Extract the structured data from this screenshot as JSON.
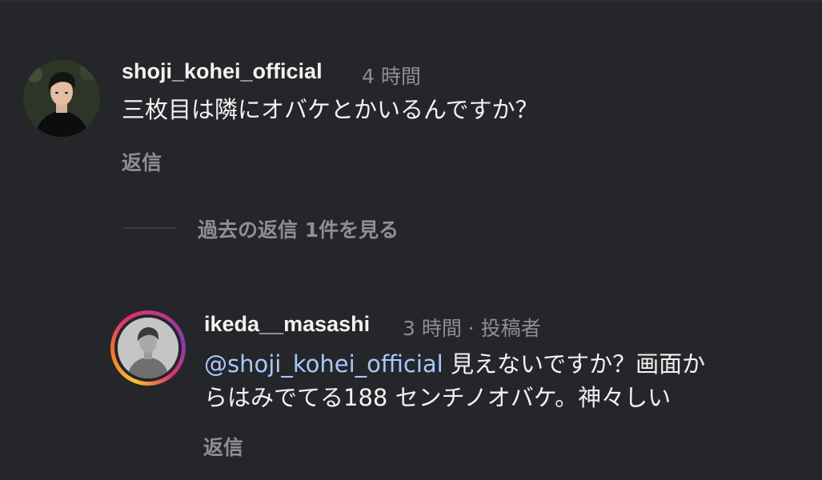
{
  "comments": [
    {
      "username": "shoji_kohei_official",
      "time": "4 時間",
      "text": "三枚目は隣にオバケとかいるんですか？",
      "reply_label": "返信"
    }
  ],
  "view_replies_label": "過去の返信 1件を見る",
  "reply": {
    "username": "ikeda__masashi",
    "time_meta": "3 時間 · 投稿者",
    "mention": "@shoji_kohei_official",
    "text_line1_rest": " 見えないですか？画面か",
    "text_line2": "らはみでてる188 センチノオバケ。神々しい",
    "reply_label": "返信"
  },
  "colors": {
    "background": "#252629",
    "text_primary": "#f2f2f2",
    "text_secondary": "#8e8f94",
    "mention": "#a8c8ff",
    "story_ring": [
      "#f6c236",
      "#ef7a2c",
      "#e1306c",
      "#c13584",
      "#833ab4"
    ]
  },
  "icons": {
    "avatar_1": "user-avatar",
    "avatar_2": "user-avatar-with-story-ring"
  }
}
